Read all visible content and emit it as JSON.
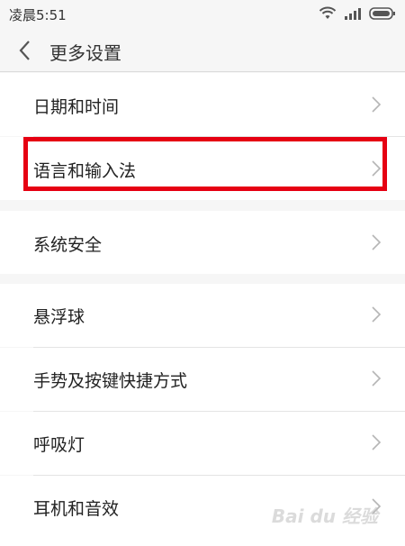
{
  "status": {
    "time": "凌晨5:51"
  },
  "header": {
    "title": "更多设置"
  },
  "groups": [
    {
      "items": [
        {
          "label": "日期和时间"
        },
        {
          "label": "语言和输入法"
        }
      ]
    },
    {
      "items": [
        {
          "label": "系统安全"
        }
      ]
    },
    {
      "items": [
        {
          "label": "悬浮球"
        },
        {
          "label": "手势及按键快捷方式"
        },
        {
          "label": "呼吸灯"
        },
        {
          "label": "耳机和音效"
        }
      ]
    }
  ],
  "watermark": "Bai du 经验",
  "colors": {
    "highlight": "#e60012",
    "background": "#f6f6f6",
    "item_bg": "#ffffff"
  }
}
